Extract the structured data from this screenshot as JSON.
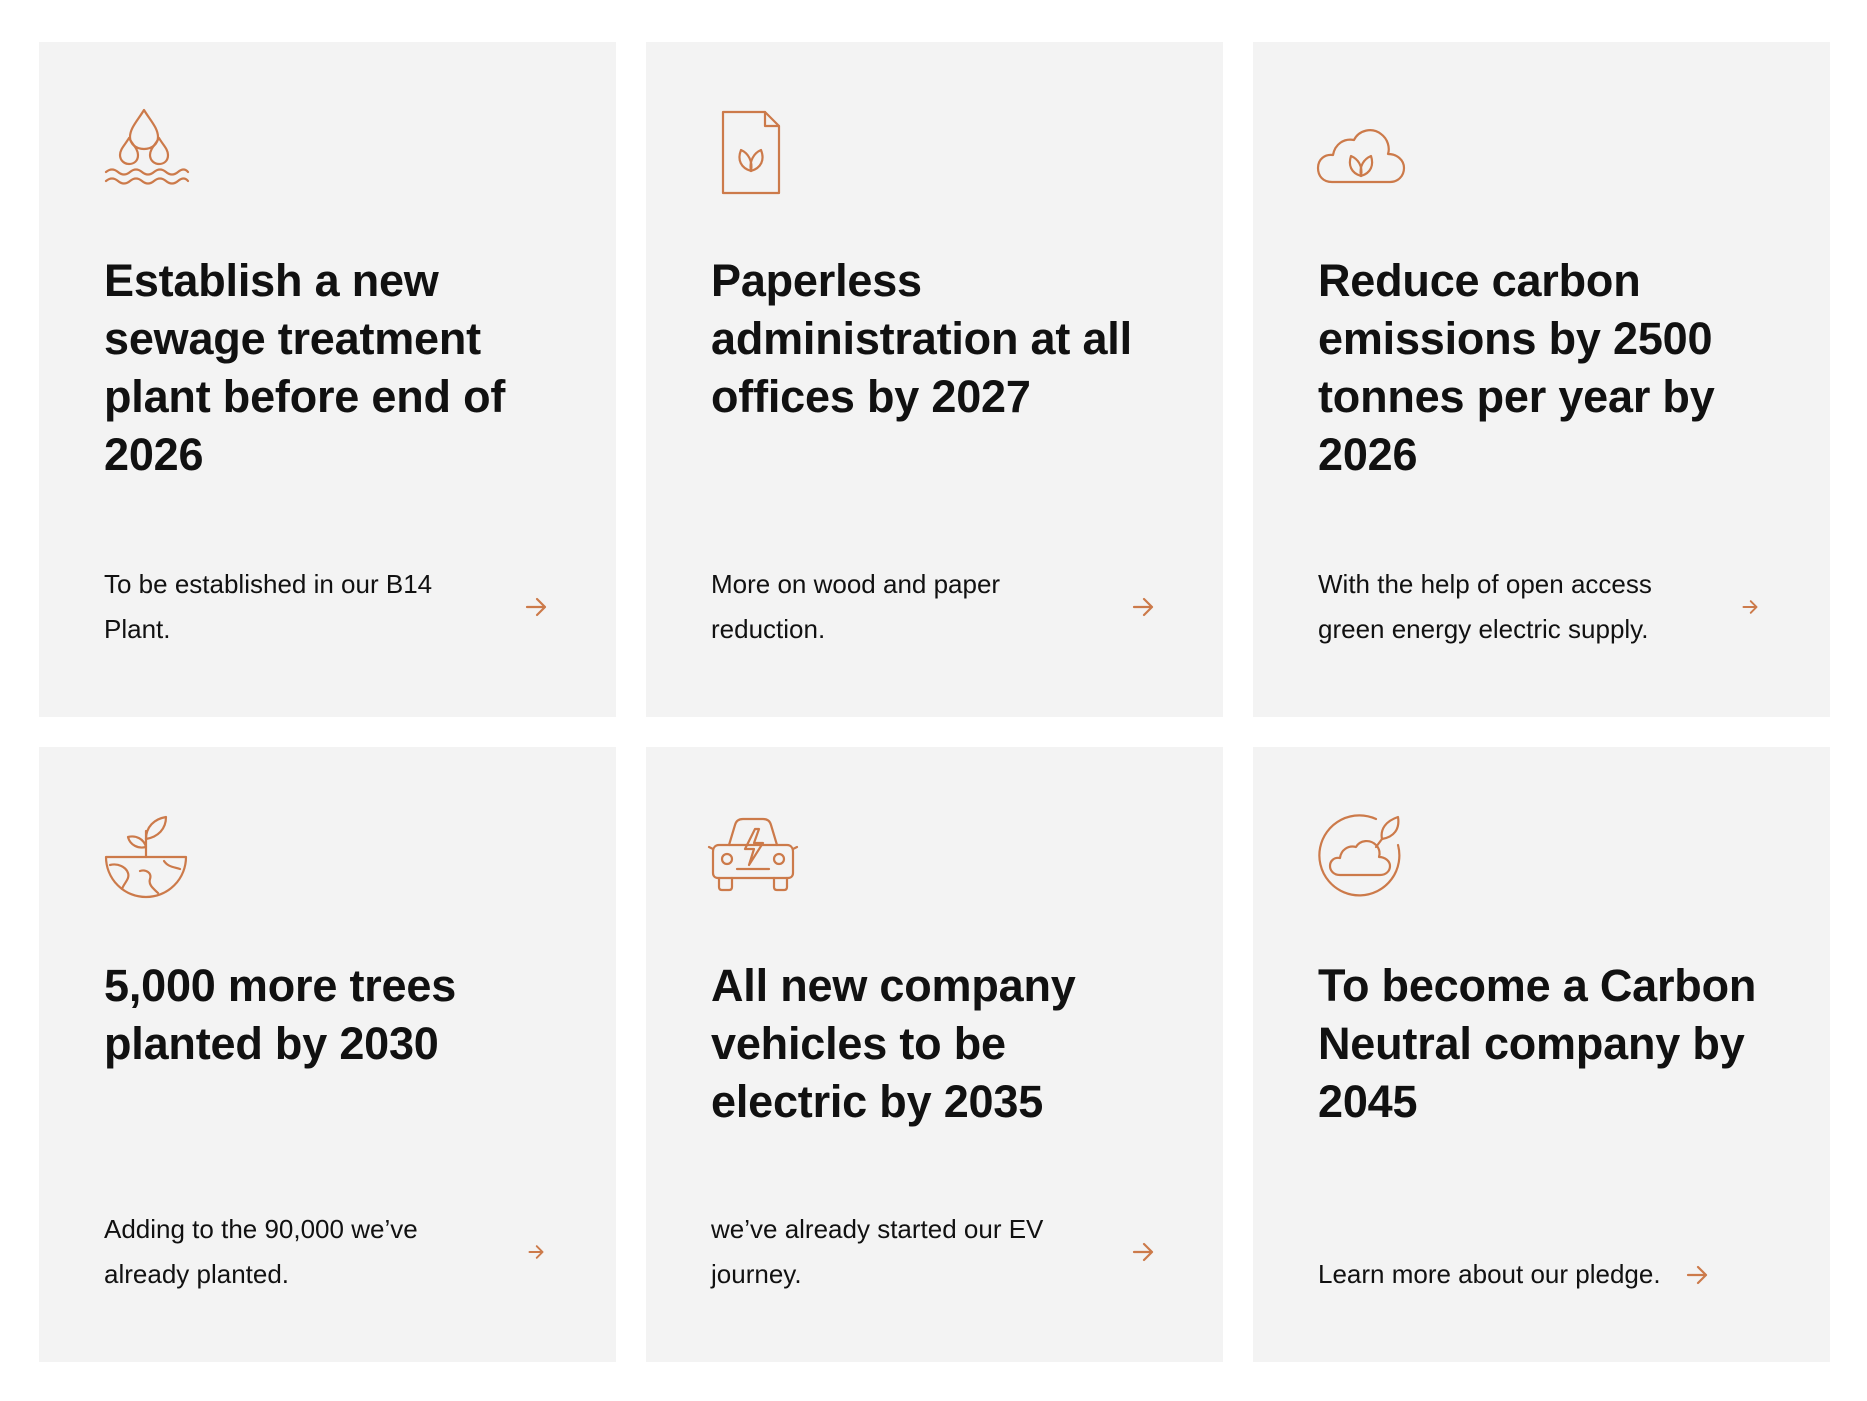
{
  "accent_color": "#cc7a4a",
  "cards": [
    {
      "icon": "water-drops-icon",
      "title": "Establish a new sewage treatment plant before end of 2026",
      "description": "To be established in our B14 Plant.",
      "link_icon": "arrow-right-icon"
    },
    {
      "icon": "paperless-document-icon",
      "title": "Paperless administration at all offices by 2027",
      "description": "More on wood and paper reduction.",
      "link_icon": "arrow-right-icon"
    },
    {
      "icon": "green-cloud-icon",
      "title": "Reduce carbon emissions by 2500 tonnes per year by 2026",
      "description": "With the help of open access green  energy electric supply.",
      "link_icon": "arrow-right-icon"
    },
    {
      "icon": "earth-sprout-icon",
      "title": "5,000 more trees planted by 2030",
      "description": "Adding to the 90,000 we’ve already planted.",
      "link_icon": "arrow-right-icon"
    },
    {
      "icon": "electric-car-icon",
      "title": "All new company vehicles to be electric by 2035",
      "description": "we’ve already started our EV journey.",
      "link_icon": "arrow-right-icon"
    },
    {
      "icon": "carbon-neutral-icon",
      "title": "To become a Carbon Neutral company by 2045",
      "description": "Learn more about our pledge.",
      "link_icon": "arrow-right-icon"
    }
  ]
}
